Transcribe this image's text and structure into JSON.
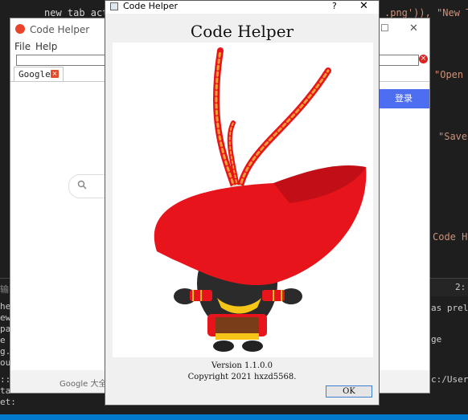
{
  "editor": {
    "line_top_code": "new_tab_acti",
    "line_top_str": ".png')), \"New Tab",
    "right_snippets": [
      "\"Open f",
      "\"Save ",
      "Code He"
    ],
    "bottom_panel_tab_left": "输",
    "bottom_panel_tab_right": "2: P",
    "terminal_left": [
      "he",
      "ew",
      "pac",
      "e '",
      "g.",
      "out",
      "",
      "::\\",
      "ta",
      "et:"
    ],
    "terminal_right": [
      "as preloa",
      "",
      "ge",
      "",
      "",
      "",
      "c:/Users,"
    ]
  },
  "browser": {
    "title": "Code Helper",
    "menu": [
      "File",
      "Help"
    ],
    "tab_label": "Google",
    "tab_close_glyph": "×",
    "address_clear_glyph": "×",
    "login_button": "登录",
    "search_icon_glyph": "🔍",
    "footer_link": "Google 大全",
    "maximize_glyph": "☐",
    "close_glyph": "✕"
  },
  "dialog": {
    "title": "Code Helper",
    "help_glyph": "?",
    "close_glyph": "✕",
    "heading": "Code Helper",
    "version": "Version 1.1.0.0",
    "copyright": "Copyright 2021 hxzd5568.",
    "ok_label": "OK"
  },
  "colors": {
    "cape_red": "#e8141c",
    "feather_orange": "#f0862a",
    "body_dark": "#2b2b2b",
    "accent_blue": "#4e6ef2"
  }
}
